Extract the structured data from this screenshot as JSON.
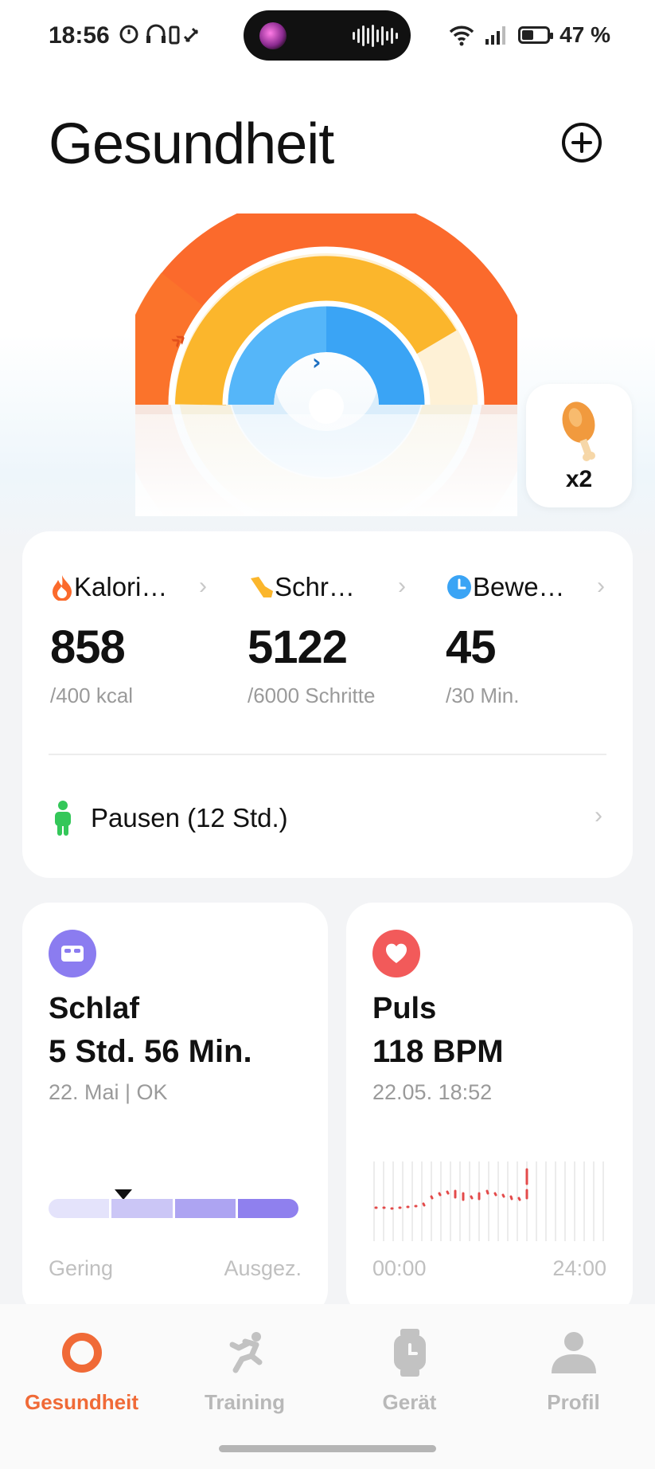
{
  "status_bar": {
    "time": "18:56",
    "battery_text": "47 %"
  },
  "header": {
    "title": "Gesundheit",
    "add_icon": "plus-circle-icon"
  },
  "rings": {
    "colors": {
      "calories": "#fb6a2c",
      "steps": "#fbb62c",
      "moves": "#3aa4f5"
    },
    "progress": {
      "calories": 1.0,
      "steps": 0.85,
      "moves": 1.0
    }
  },
  "reward": {
    "icon": "drumstick-icon",
    "count": "x2"
  },
  "activity": {
    "metrics": [
      {
        "label": "Kalori…",
        "value": "858",
        "goal": "/400 kcal",
        "icon": "flame-icon",
        "color": "#fb6a2c"
      },
      {
        "label": "Schr…",
        "value": "5122",
        "goal": "/6000 Schritte",
        "icon": "shoe-icon",
        "color": "#fbb62c"
      },
      {
        "label": "Bewe…",
        "value": "45",
        "goal": "/30 Min.",
        "icon": "clock-icon",
        "color": "#3aa4f5"
      }
    ],
    "pause_label": "Pausen (12 Std.)"
  },
  "sleep": {
    "title": "Schlaf",
    "value": "5 Std. 56 Min.",
    "subtitle": "22. Mai | OK",
    "low_label": "Gering",
    "high_label": "Ausgez.",
    "quality_level": 0.3,
    "bar_colors": [
      "#e4e3fb",
      "#cbc6f6",
      "#ada4f2",
      "#8f80ee"
    ]
  },
  "pulse": {
    "title": "Puls",
    "value": "118 BPM",
    "subtitle": "22.05. 18:52",
    "start_label": "00:00",
    "end_label": "24:00"
  },
  "nav": {
    "items": [
      {
        "label": "Gesundheit",
        "icon": "health-ring-icon",
        "active": true
      },
      {
        "label": "Training",
        "icon": "running-icon",
        "active": false
      },
      {
        "label": "Gerät",
        "icon": "watch-icon",
        "active": false
      },
      {
        "label": "Profil",
        "icon": "person-icon",
        "active": false
      }
    ]
  }
}
